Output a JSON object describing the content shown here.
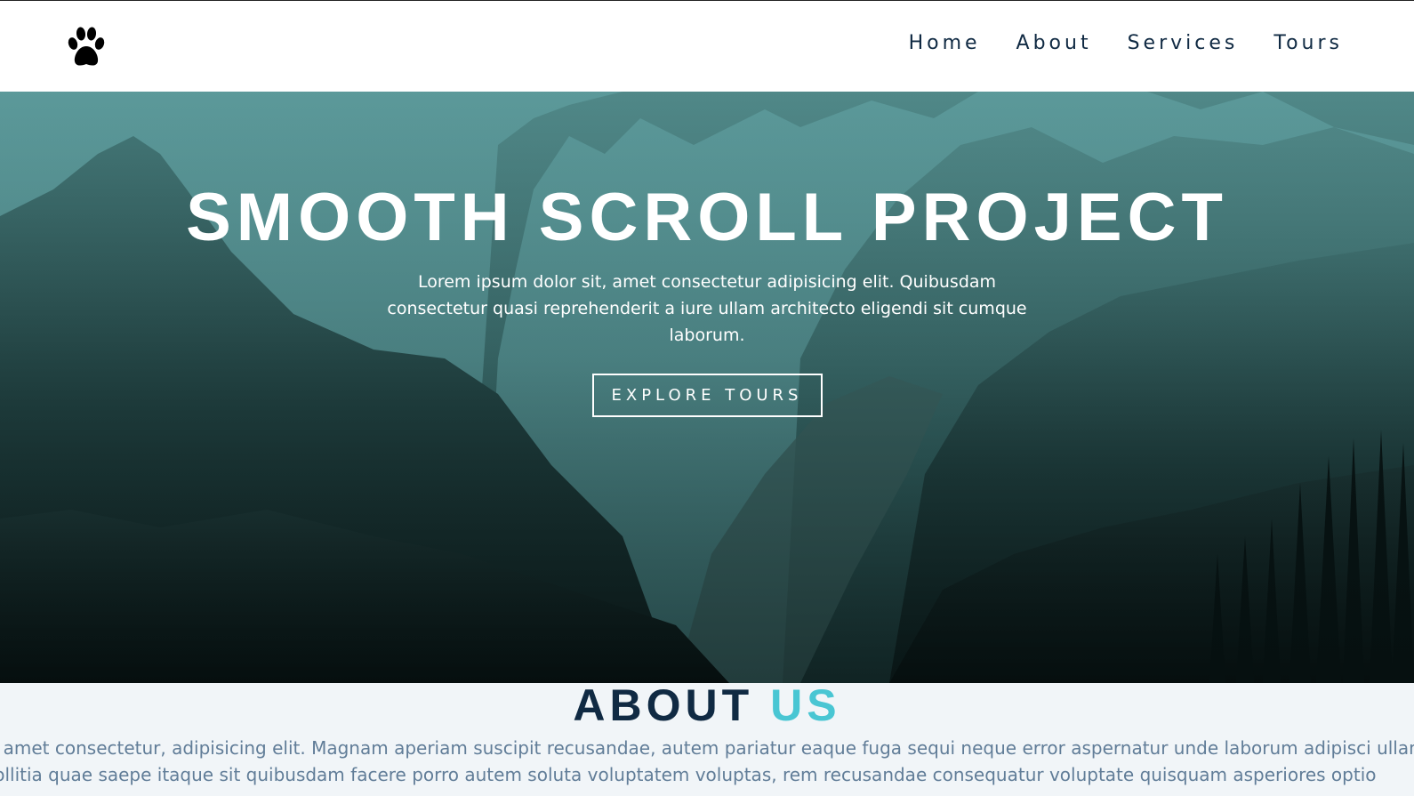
{
  "nav": {
    "logo_icon": "paw-icon",
    "links": [
      "Home",
      "About",
      "Services",
      "Tours"
    ]
  },
  "hero": {
    "title": "SMOOTH SCROLL PROJECT",
    "text": "Lorem ipsum dolor sit, amet consectetur adipisicing elit. Quibusdam consectetur quasi reprehenderit a iure ullam architecto eligendi sit cumque laborum.",
    "button": "EXPLORE TOURS"
  },
  "about": {
    "title_main": "ABOUT",
    "title_accent": "US",
    "lines": [
      "Lorem ipsum dolor sit amet consectetur, adipisicing elit. Magnam aperiam suscipit recusandae, autem pariatur eaque fuga sequi neque error aspernatur unde laborum adipisci ullam at, excepturi",
      "cumque. Molestias mollitia quae saepe itaque sit quibusdam facere porro autem soluta voluptatem voluptas, rem recusandae consequatur voluptate quisquam asperiores optio"
    ]
  },
  "colors": {
    "accent": "#49c6d3",
    "heading": "#102a43",
    "body_text": "#617d98",
    "section_bg": "#f1f5f8"
  }
}
